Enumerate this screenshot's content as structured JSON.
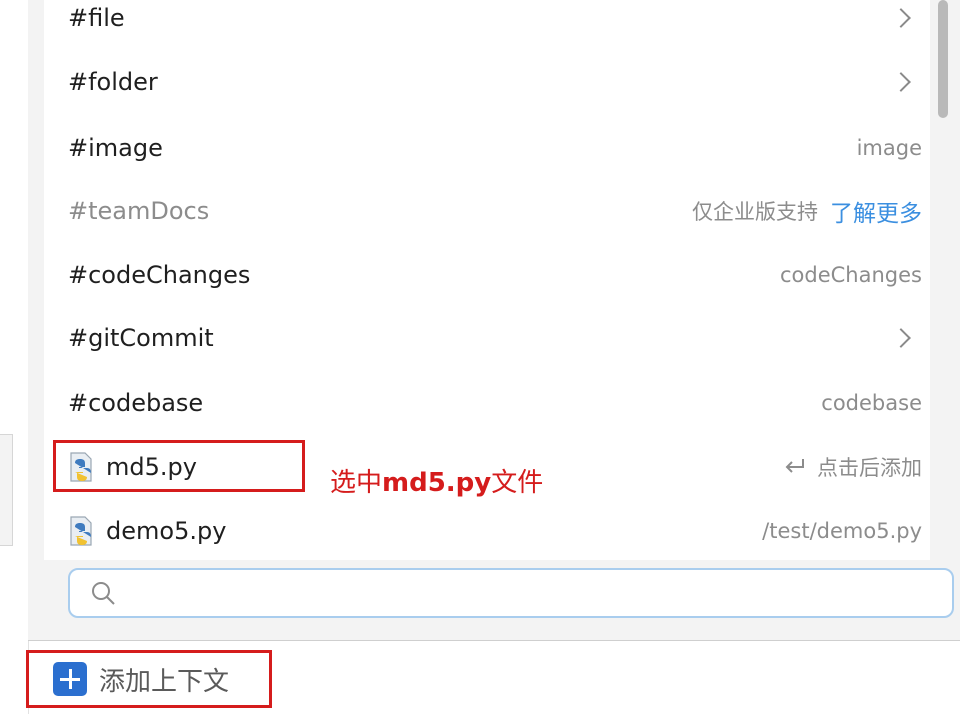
{
  "menu": {
    "items": [
      {
        "label": "#file",
        "right": "",
        "chevron": true
      },
      {
        "label": "#folder",
        "right": "",
        "chevron": true
      },
      {
        "label": "#image",
        "right": "image",
        "chevron": false
      },
      {
        "label": "#teamDocs",
        "right": "仅企业版支持",
        "link": "了解更多",
        "disabled": true
      },
      {
        "label": "#codeChanges",
        "right": "codeChanges",
        "chevron": false
      },
      {
        "label": "#gitCommit",
        "right": "",
        "chevron": true
      },
      {
        "label": "#codebase",
        "right": "codebase",
        "chevron": false
      },
      {
        "label": "md5.py",
        "right": "点击后添加",
        "icon": "python-file-icon",
        "enter": true
      },
      {
        "label": "demo5.py",
        "right": "/test/demo5.py",
        "icon": "python-file-icon"
      }
    ]
  },
  "search": {
    "placeholder": "",
    "value": ""
  },
  "annotation": {
    "prefix": "选中",
    "bold": "md5.py",
    "suffix": "文件"
  },
  "add_context": {
    "label": "添加上下文"
  },
  "colors": {
    "accent": "#2b6fcf",
    "annotation": "#d51c1c",
    "link": "#3b8fe0"
  }
}
